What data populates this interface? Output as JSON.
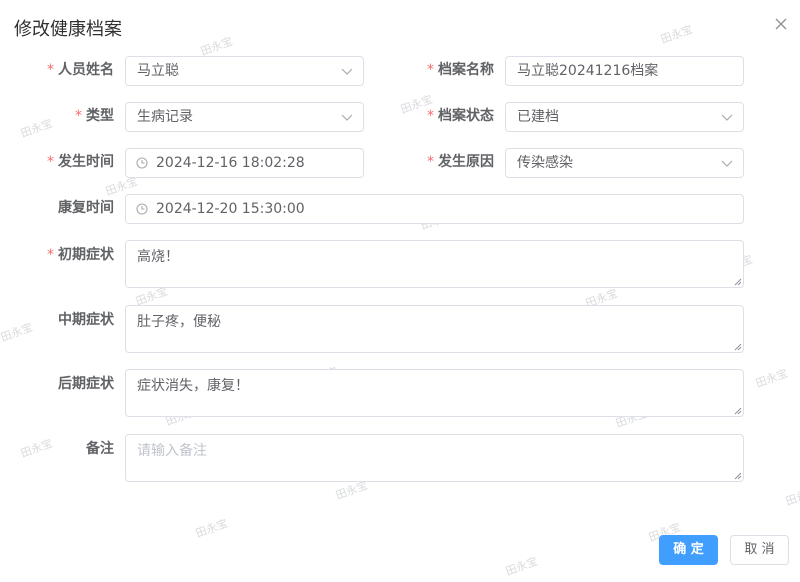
{
  "dialog": {
    "title": "修改健康档案"
  },
  "form": {
    "person_name": {
      "label": "人员姓名",
      "required": true,
      "value": "马立聪"
    },
    "archive_name": {
      "label": "档案名称",
      "required": true,
      "value": "马立聪20241216档案"
    },
    "type": {
      "label": "类型",
      "required": true,
      "value": "生病记录"
    },
    "archive_status": {
      "label": "档案状态",
      "required": true,
      "value": "已建档"
    },
    "occur_time": {
      "label": "发生时间",
      "required": true,
      "value": "2024-12-16 18:02:28"
    },
    "occur_reason": {
      "label": "发生原因",
      "required": true,
      "value": "传染感染"
    },
    "recover_time": {
      "label": "康复时间",
      "required": false,
      "value": "2024-12-20 15:30:00"
    },
    "early_symptom": {
      "label": "初期症状",
      "required": true,
      "value": "高烧！"
    },
    "middle_symptom": {
      "label": "中期症状",
      "required": false,
      "value": "肚子疼，便秘"
    },
    "late_symptom": {
      "label": "后期症状",
      "required": false,
      "value": "症状消失，康复！"
    },
    "remark": {
      "label": "备注",
      "required": false,
      "value": "",
      "placeholder": "请输入备注"
    }
  },
  "footer": {
    "confirm_label": "确 定",
    "cancel_label": "取 消"
  },
  "watermark": {
    "text": "田永宝"
  },
  "icons": {
    "close": "close-icon",
    "chevron": "chevron-down-icon",
    "clock": "clock-icon"
  },
  "colors": {
    "primary": "#409eff",
    "required": "#f56c6c",
    "border": "#dcdfe6",
    "text": "#606266",
    "placeholder": "#c0c4cc"
  }
}
